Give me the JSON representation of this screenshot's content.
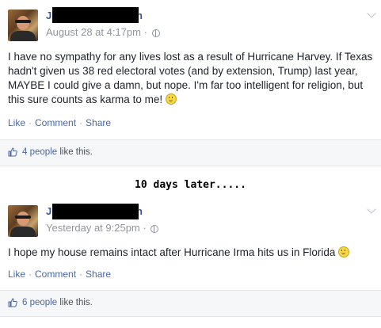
{
  "posts": [
    {
      "author_first_letter": "J",
      "author_last_letter": "h",
      "timestamp": "August 28 at 4:17pm",
      "meta_separator": "·",
      "body": "I have no sympathy for any lives lost as a result of Hurricane Harvey. If Texas hadn't given us 38 red electoral votes (and by extension, Trump) last year, MAYBE I could give a damn, but nope. I'm far too intelligent for religion, but this sure counts as karma to me!",
      "actions": {
        "like": "Like",
        "comment": "Comment",
        "share": "Share",
        "separator": "·"
      },
      "likes": {
        "count_link": "4 people",
        "suffix": "like this."
      }
    },
    {
      "author_first_letter": "J",
      "author_last_letter": "h",
      "timestamp": "Yesterday at 9:25pm",
      "meta_separator": "·",
      "body": "I hope my house remains intact after Hurricane Irma hits us in Florida",
      "actions": {
        "like": "Like",
        "comment": "Comment",
        "share": "Share",
        "separator": "·"
      },
      "likes": {
        "count_link": "6 people",
        "suffix": "like this."
      }
    }
  ],
  "caption": "10 days later.....",
  "icons": {
    "avatar": "profile-photo",
    "globe": "globe-icon",
    "chevron": "chevron-down-icon",
    "thumb": "thumbs-up-icon",
    "emoji": "smile-emoji-icon"
  },
  "colors": {
    "link": "#4b67a1",
    "name": "#3b5998",
    "meta": "#90949c",
    "text": "#1d2129",
    "likes_bar_bg": "#f6f7f9",
    "redaction": "#000000"
  }
}
